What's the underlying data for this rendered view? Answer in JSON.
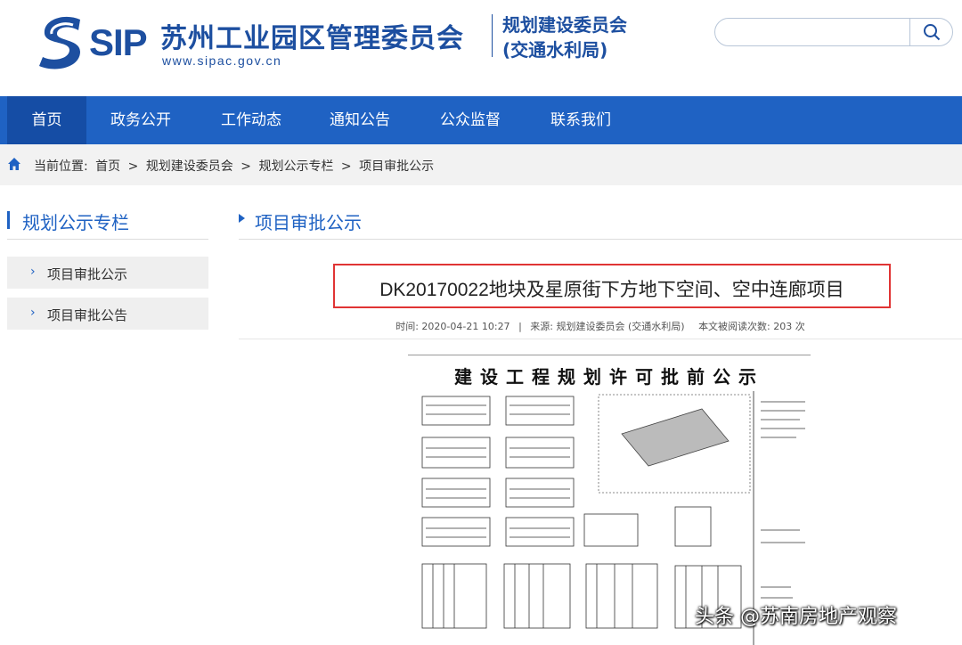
{
  "header": {
    "logo_text": "SIP",
    "org_name": "苏州工业园区管理委员会",
    "url": "www.sipac.gov.cn",
    "dept_line1": "规划建设委员会",
    "dept_line2": "(交通水利局)",
    "search_placeholder": ""
  },
  "nav": {
    "items": [
      {
        "label": "首页",
        "active": true
      },
      {
        "label": "政务公开"
      },
      {
        "label": "工作动态"
      },
      {
        "label": "通知公告"
      },
      {
        "label": "公众监督"
      },
      {
        "label": "联系我们"
      }
    ]
  },
  "breadcrumb": {
    "prefix": "当前位置:",
    "items": [
      "首页",
      ">",
      "规划建设委员会",
      ">",
      "规划公示专栏",
      ">",
      "项目审批公示"
    ]
  },
  "sidebar": {
    "title": "规划公示专栏",
    "items": [
      {
        "label": "项目审批公示"
      },
      {
        "label": "项目审批公告"
      }
    ]
  },
  "main": {
    "section_title": "项目审批公示",
    "article_title": "DK20170022地块及星原街下方地下空间、空中连廊项目",
    "meta": {
      "time": "时间: 2020-04-21 10:27",
      "source": "来源: 规划建设委员会 (交通水利局)",
      "views": "本文被阅读次数: 203 次"
    },
    "poster_title": "建设工程规划许可批前公示"
  },
  "watermark": "头条 @苏南房地产观察",
  "colors": {
    "brand": "#1d4fa0",
    "nav_bg": "#1f62c3",
    "nav_active": "#154da5",
    "highlight_border": "#e03434"
  }
}
